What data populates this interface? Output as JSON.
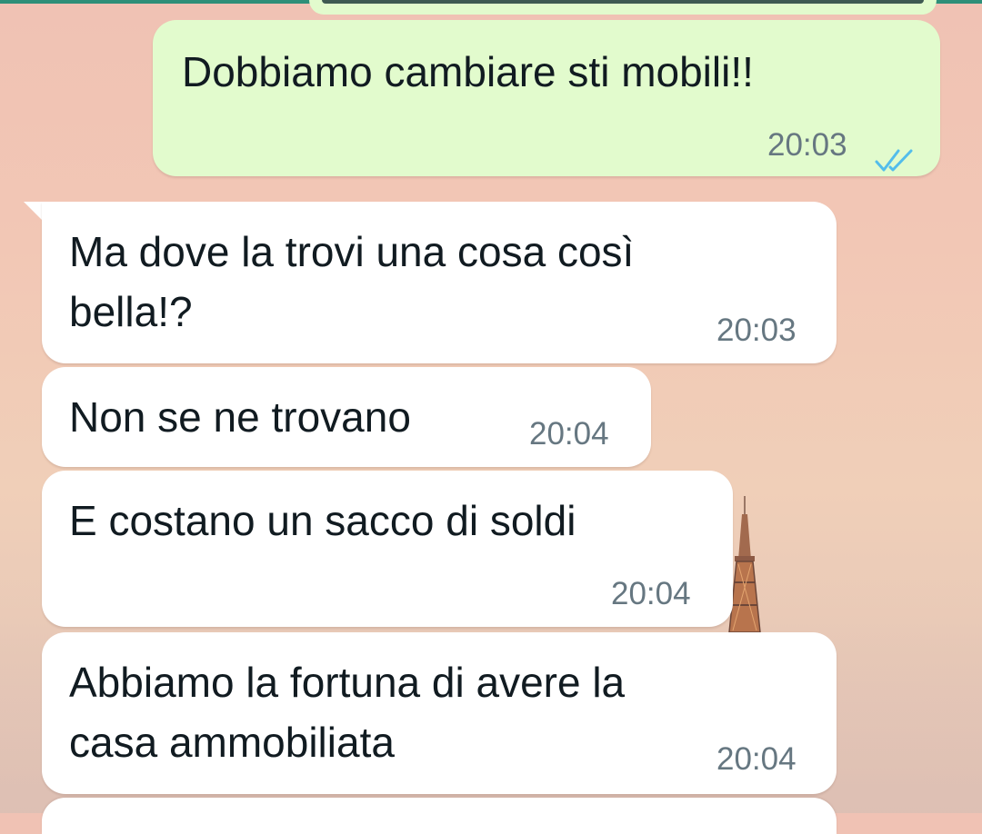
{
  "messages": [
    {
      "direction": "outgoing",
      "lines": [
        "Dobbiamo cambiare sti mobili!!"
      ],
      "time": "20:03",
      "status": "read",
      "status_icon": "double-check-icon",
      "status_color": "#53bdeb"
    },
    {
      "direction": "incoming",
      "lines": [
        "Ma dove la trovi una cosa così",
        "bella!?"
      ],
      "time": "20:03"
    },
    {
      "direction": "incoming",
      "lines": [
        "Non se ne trovano"
      ],
      "time": "20:04"
    },
    {
      "direction": "incoming",
      "lines": [
        "E costano un sacco di soldi"
      ],
      "time": "20:04"
    },
    {
      "direction": "incoming",
      "lines": [
        "Abbiamo la fortuna di avere la",
        "casa ammobiliata"
      ],
      "time": "20:04"
    }
  ],
  "colors": {
    "outgoing_bubble": "#e2fbcd",
    "incoming_bubble": "#ffffff",
    "message_text": "#111b21",
    "time_text": "#667781",
    "read_check": "#53bdeb",
    "header_accent": "#2e8f79"
  },
  "wallpaper": {
    "description_icon": "eiffel-tower-icon"
  }
}
